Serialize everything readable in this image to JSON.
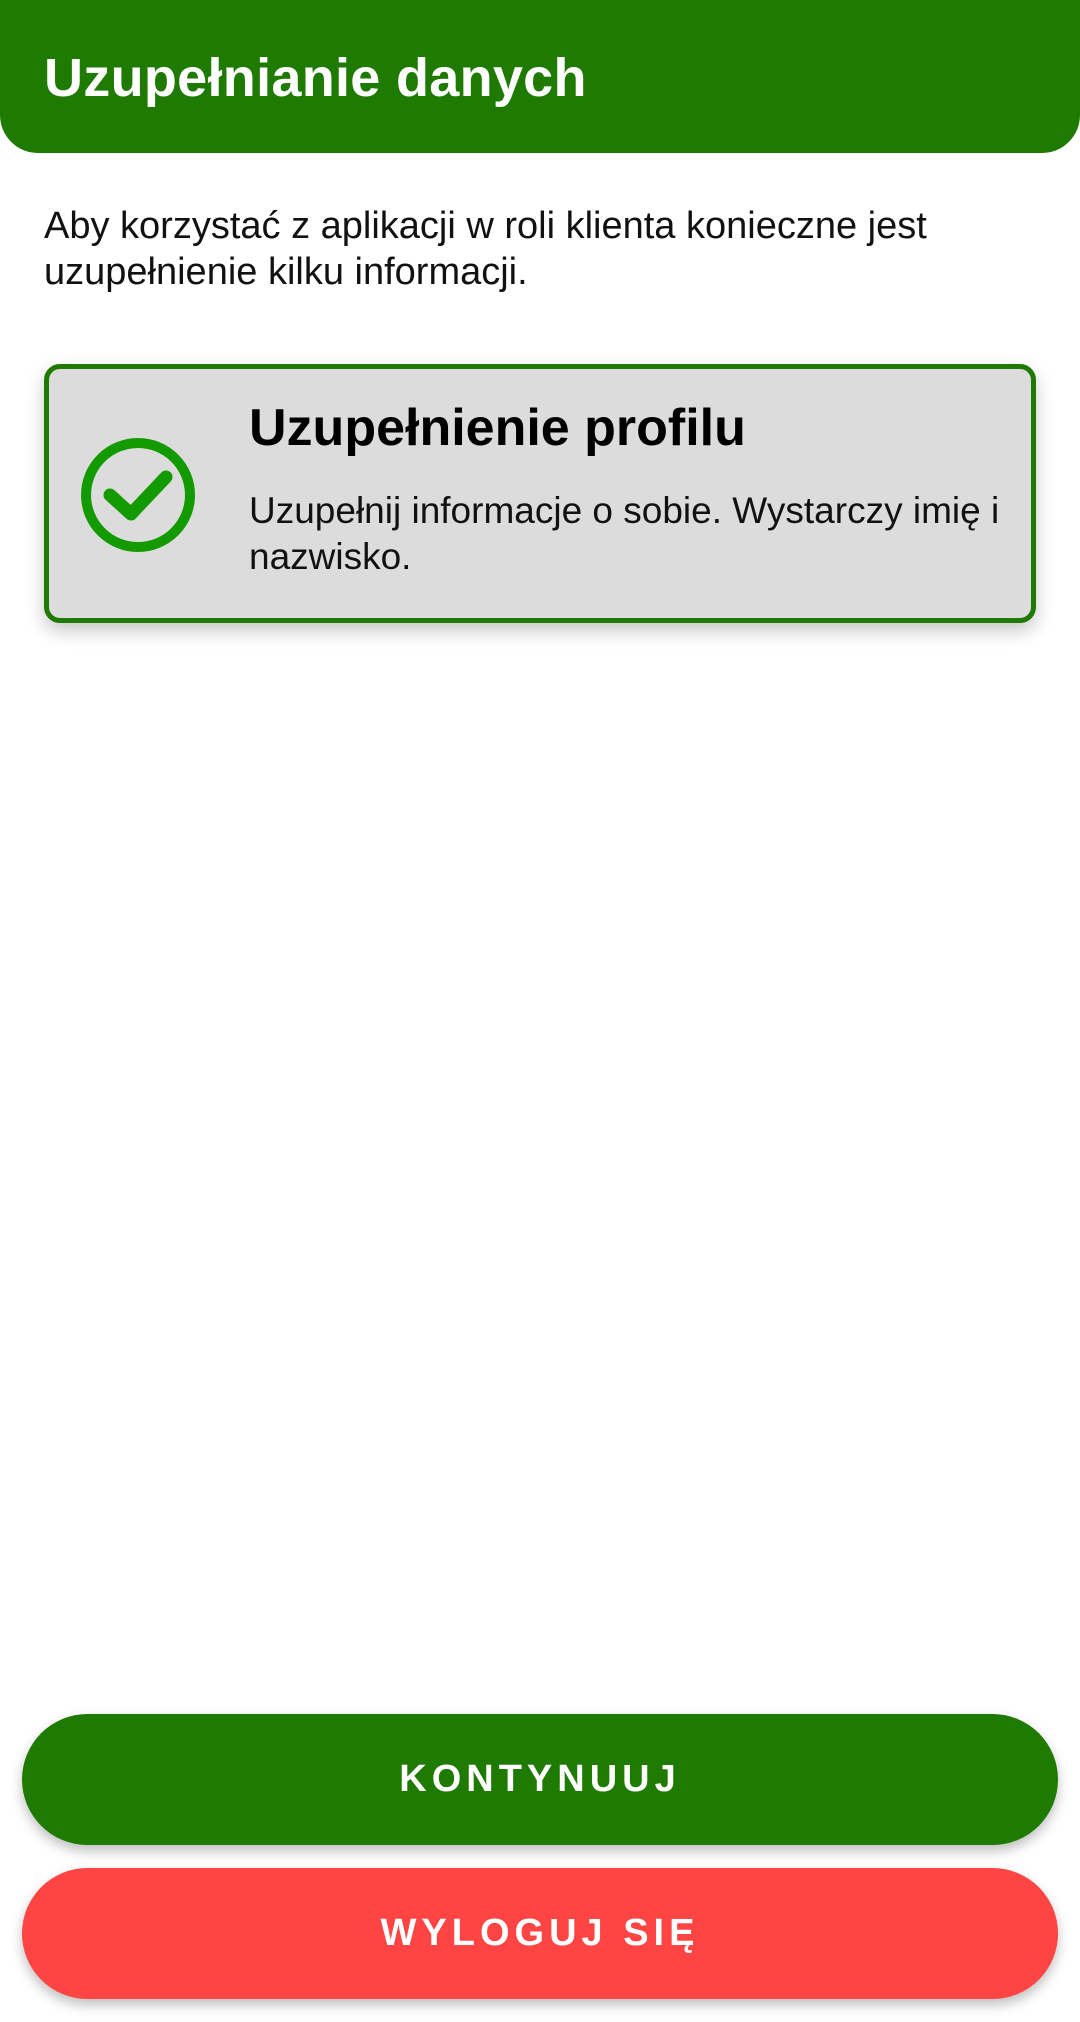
{
  "header": {
    "title": "Uzupełnianie danych"
  },
  "intro": {
    "text": "Aby korzystać z aplikacji w roli klienta konieczne jest uzupełnienie kilku informacji."
  },
  "task_card": {
    "title": "Uzupełnienie profilu",
    "description": "Uzupełnij informacje o sobie. Wystarczy imię i nazwisko.",
    "status_icon": "check-circle-icon",
    "completed": true
  },
  "buttons": {
    "continue_label": "KONTYNUUJ",
    "logout_label": "WYLOGUJ SIĘ"
  },
  "colors": {
    "primary": "#1e7a00",
    "check": "#129a00",
    "danger": "#ff4444",
    "card_bg": "#dcdcdc"
  }
}
